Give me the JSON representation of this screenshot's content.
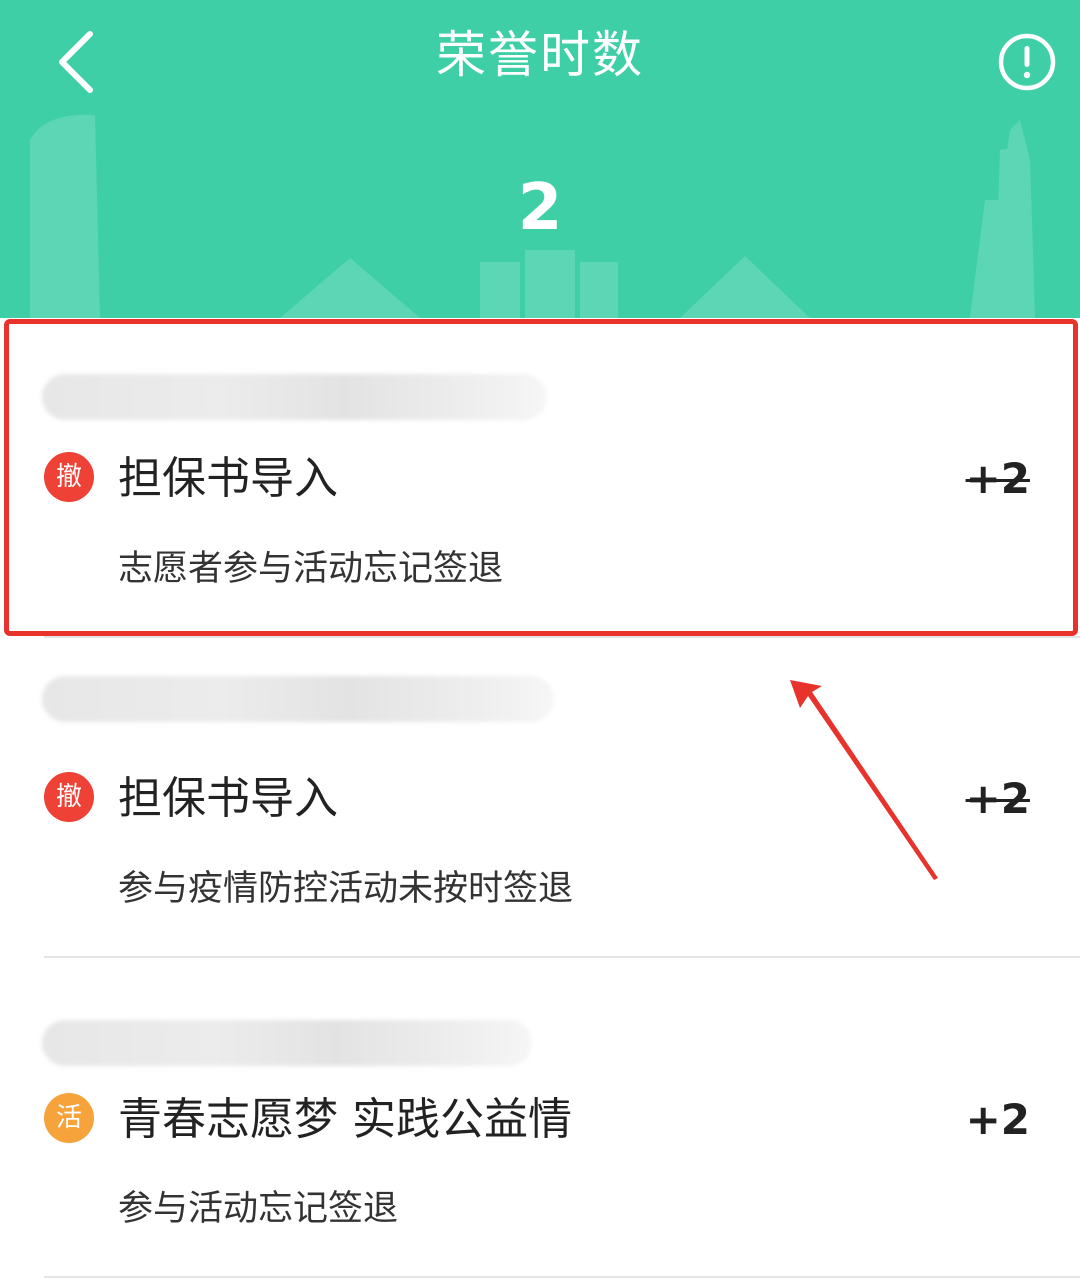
{
  "header": {
    "title": "荣誉时数",
    "total_hours": "2",
    "background_color": "#3ecfa7",
    "back_icon": "chevron-left-icon",
    "info_icon": "info-circle-icon"
  },
  "records": [
    {
      "badge": "撤",
      "badge_color": "#ef4136",
      "title": "担保书导入",
      "points": "+2",
      "points_struck": true,
      "description": "志愿者参与活动忘记签退"
    },
    {
      "badge": "撤",
      "badge_color": "#ef4136",
      "title": "担保书导入",
      "points": "+2",
      "points_struck": true,
      "description": "参与疫情防控活动未按时签退"
    },
    {
      "badge": "活",
      "badge_color": "#f6a33c",
      "title": "青春志愿梦 实践公益情",
      "points": "+2",
      "points_struck": false,
      "description": "参与活动忘记签退"
    }
  ],
  "annotation": {
    "highlight_color": "#e8322c"
  }
}
